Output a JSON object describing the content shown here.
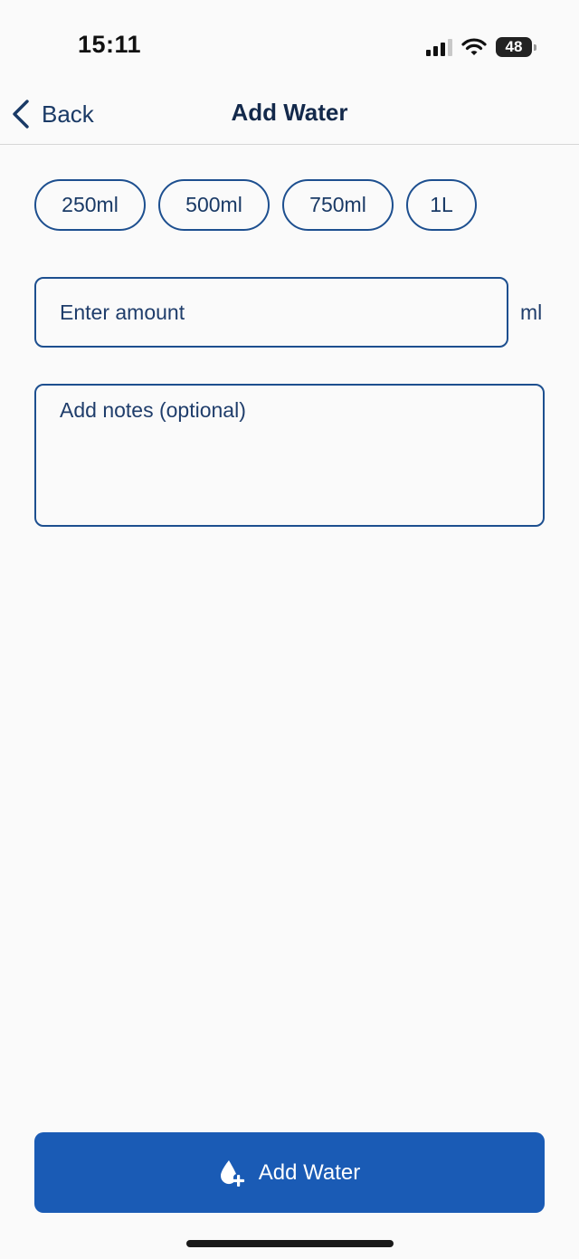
{
  "status_bar": {
    "time": "15:11",
    "battery_level": "48",
    "icons": [
      "cellular-signal-icon",
      "wifi-icon",
      "battery-icon"
    ]
  },
  "nav": {
    "back_label": "Back",
    "back_icon": "chevron-left-icon",
    "title": "Add Water"
  },
  "presets": [
    "250ml",
    "500ml",
    "750ml",
    "1L"
  ],
  "amount": {
    "value": "",
    "placeholder": "Enter amount",
    "unit": "ml"
  },
  "notes": {
    "value": "",
    "placeholder": "Add notes (optional)"
  },
  "primary_button": {
    "label": "Add Water",
    "icon": "water-drop-plus-icon"
  },
  "colors": {
    "accent": "#1a5bb5",
    "border": "#1d4f8f",
    "text": "#1a3a66",
    "background": "#fafafa"
  }
}
